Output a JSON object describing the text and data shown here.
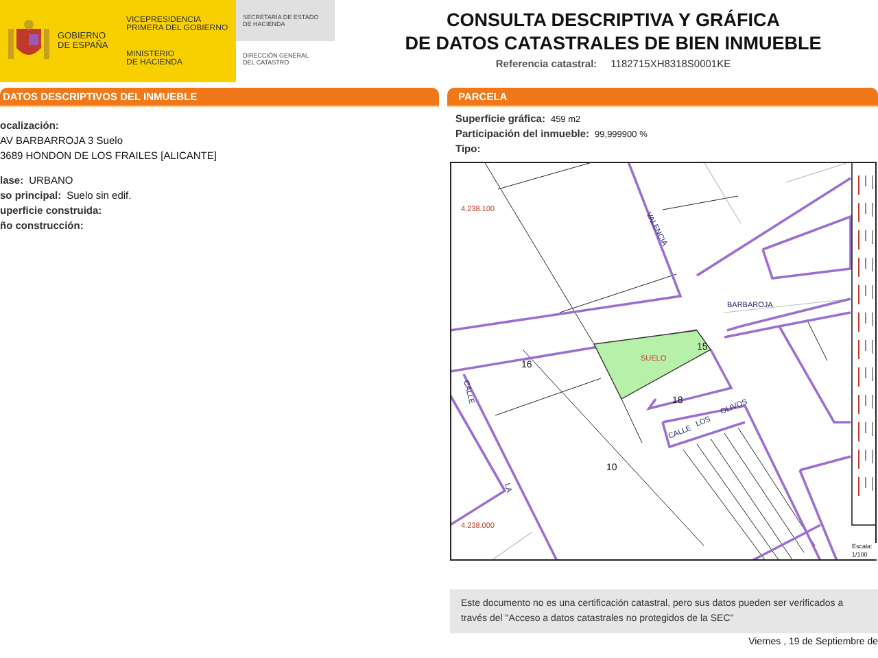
{
  "header": {
    "government": [
      "GOBIERNO",
      "DE ESPAÑA"
    ],
    "vicepresidency": [
      "VICEPRESIDENCIA",
      "PRIMERA DEL GOBIERNO"
    ],
    "ministry": [
      "MINISTERIO",
      "DE HACIENDA"
    ],
    "secretariat": [
      "SECRETARÍA DE ESTADO",
      "DE HACIENDA"
    ],
    "directorate": [
      "DIRECCIÓN GENERAL",
      "DEL CATASTRO"
    ]
  },
  "title_lines": [
    "CONSULTA DESCRIPTIVA Y GRÁFICA",
    "DE DATOS CATASTRALES DE BIEN INMUEBLE"
  ],
  "reference": {
    "label": "Referencia catastral:",
    "value": "1182715XH8318S0001KE"
  },
  "left_panel": {
    "title": "DATOS DESCRIPTIVOS DEL INMUEBLE",
    "location_label": "ocalización:",
    "address_lines": [
      "AV BARBARROJA 3 Suelo",
      "3689 HONDON DE LOS FRAILES [ALICANTE]"
    ],
    "fields": [
      {
        "label": "lase:",
        "value": "URBANO"
      },
      {
        "label": "so principal:",
        "value": "Suelo sin edif."
      },
      {
        "label": "uperficie construida:"
      },
      {
        "label": "ño construcción:"
      }
    ]
  },
  "parcel_panel": {
    "title": "PARCELA",
    "fields": [
      {
        "label": "Superficie gráfica:",
        "value": "459 m2"
      },
      {
        "label": "Participación del inmueble:",
        "value": "99,999900 %"
      },
      {
        "label": "Tipo:"
      }
    ],
    "map": {
      "labels": [
        {
          "text": "4.238.100",
          "kind": "coordinate"
        },
        {
          "text": "VALENCIA",
          "kind": "street"
        },
        {
          "text": "BARBAROJA",
          "kind": "street"
        },
        {
          "text": "SUELO",
          "kind": "coordinate"
        },
        {
          "text": "15",
          "kind": "parcel"
        },
        {
          "text": "16",
          "kind": "parcel"
        },
        {
          "text": "18",
          "kind": "parcel"
        },
        {
          "text": "10",
          "kind": "parcel"
        },
        {
          "text": "CALLE",
          "kind": "street"
        },
        {
          "text": "LOS",
          "kind": "street"
        },
        {
          "text": "OLIVOS",
          "kind": "street"
        },
        {
          "text": "CALLE",
          "kind": "street"
        },
        {
          "text": "LA",
          "kind": "street"
        },
        {
          "text": "4.238.000",
          "kind": "coordinate"
        }
      ],
      "scale_label": "Escala:",
      "scale_value": "1/100"
    }
  },
  "notice": "Este documento no es una certificación catastral, pero sus datos pueden ser verificados a través del \"Acceso a datos catastrales no protegidos de la SEC\"",
  "date": "Viernes , 19 de Septiembre de"
}
